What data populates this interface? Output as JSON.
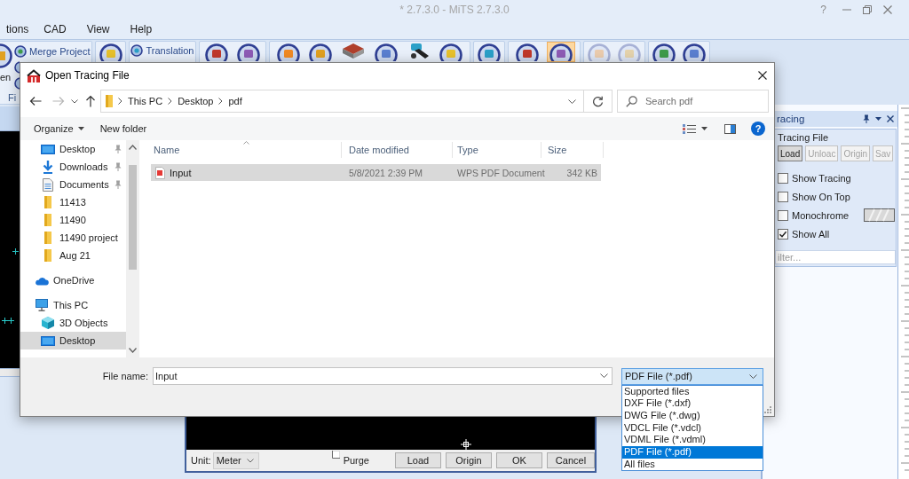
{
  "app": {
    "title": "* 2.7.3.0 - MiTS 2.7.3.0",
    "help": "?"
  },
  "menu": [
    {
      "label": "tions"
    },
    {
      "label": "CAD"
    },
    {
      "label": "View"
    },
    {
      "label": "Help"
    }
  ],
  "ribbon": {
    "groups": [
      {
        "label": "Fi",
        "items": [
          {
            "kind": "large",
            "label": "en",
            "active": false,
            "disabled": false
          },
          {
            "kind": "small",
            "label": "Merge Project",
            "active": false,
            "disabled": false
          },
          {
            "kind": "small",
            "active": false,
            "disabled": false
          },
          {
            "kind": "small",
            "active": false,
            "disabled": false
          }
        ]
      },
      {
        "items": [
          {
            "kind": "round",
            "active": false,
            "disabled": false
          }
        ]
      },
      {
        "items": [
          {
            "kind": "small",
            "label": "Translation",
            "active": false,
            "disabled": false
          }
        ]
      },
      {
        "items": [
          {
            "kind": "round",
            "active": false,
            "disabled": false
          },
          {
            "kind": "round",
            "active": false,
            "disabled": false
          }
        ]
      },
      {
        "items": [
          {
            "kind": "round",
            "active": false,
            "disabled": false
          },
          {
            "kind": "round",
            "active": false,
            "disabled": false
          },
          {
            "kind": "slab",
            "active": false,
            "disabled": false
          },
          {
            "kind": "round",
            "active": false,
            "disabled": false
          },
          {
            "kind": "machine",
            "active": false,
            "disabled": false
          },
          {
            "kind": "round",
            "active": false,
            "disabled": false
          }
        ]
      },
      {
        "items": [
          {
            "kind": "round",
            "active": false,
            "disabled": false
          }
        ]
      },
      {
        "items": [
          {
            "kind": "round",
            "active": false,
            "disabled": false
          },
          {
            "kind": "round",
            "active": true,
            "disabled": false
          }
        ]
      },
      {
        "items": [
          {
            "kind": "round",
            "active": false,
            "disabled": true
          },
          {
            "kind": "round",
            "active": false,
            "disabled": true
          }
        ]
      },
      {
        "items": [
          {
            "kind": "round",
            "active": false,
            "disabled": false
          },
          {
            "kind": "round",
            "active": false,
            "disabled": false
          }
        ]
      }
    ]
  },
  "dialog": {
    "title": "Open Tracing File",
    "address": {
      "crumbs": [
        "This PC",
        "Desktop",
        "pdf"
      ]
    },
    "search": {
      "placeholder": "Search pdf"
    },
    "toolbar": {
      "organize": "Organize",
      "new_folder": "New folder",
      "help": "?"
    },
    "nav": {
      "quick_access": [
        {
          "label": "Desktop",
          "kind": "desktop",
          "pinned": true,
          "selected": false
        },
        {
          "label": "Downloads",
          "kind": "downloads",
          "pinned": true,
          "selected": false
        },
        {
          "label": "Documents",
          "kind": "documents",
          "pinned": true,
          "selected": false
        },
        {
          "label": "11413",
          "kind": "folder",
          "pinned": false,
          "selected": false
        },
        {
          "label": "11490",
          "kind": "folder",
          "pinned": false,
          "selected": false
        },
        {
          "label": "11490 project",
          "kind": "folder",
          "pinned": false,
          "selected": false
        },
        {
          "label": "Aug 21",
          "kind": "folder",
          "pinned": false,
          "selected": false
        }
      ],
      "items": [
        {
          "label": "OneDrive",
          "kind": "cloud",
          "selected": false
        },
        {
          "label": "This PC",
          "kind": "pc",
          "selected": false,
          "children": [
            {
              "label": "3D Objects",
              "kind": "cube",
              "selected": false
            },
            {
              "label": "Desktop",
              "kind": "desktop",
              "selected": true
            }
          ]
        }
      ]
    },
    "columns": [
      {
        "label": "Name",
        "sorted": true
      },
      {
        "label": "Date modified",
        "sorted": false
      },
      {
        "label": "Type",
        "sorted": false
      },
      {
        "label": "Size",
        "sorted": false
      }
    ],
    "files": [
      {
        "name": "Input",
        "date": "5/8/2021 2:39 PM",
        "type": "WPS PDF Document",
        "size": "342 KB",
        "selected": true
      }
    ],
    "file_name": {
      "label": "File name:",
      "value": "Input"
    },
    "file_type": {
      "value": "PDF File (*.pdf)",
      "expanded": true,
      "options": [
        {
          "label": "Supported files",
          "selected": false
        },
        {
          "label": "DXF File (*.dxf)",
          "selected": false
        },
        {
          "label": "DWG File (*.dwg)",
          "selected": false
        },
        {
          "label": "VDCL File (*.vdcl)",
          "selected": false
        },
        {
          "label": "VDML File (*.vdml)",
          "selected": false
        },
        {
          "label": "PDF File (*.pdf)",
          "selected": true
        },
        {
          "label": "All files",
          "selected": false
        }
      ]
    }
  },
  "tracing_panel": {
    "title": "racing",
    "group_label": "Tracing File",
    "buttons": [
      {
        "label": "Load",
        "disabled": false
      },
      {
        "label": "Unloac",
        "disabled": true
      },
      {
        "label": "Origin",
        "disabled": true
      },
      {
        "label": "Sav",
        "disabled": true
      }
    ],
    "options": [
      {
        "label": "Show Tracing",
        "kind": "check",
        "checked": false
      },
      {
        "label": "Show On Top",
        "kind": "check",
        "checked": false
      },
      {
        "label": "Monochrome",
        "kind": "check-swatch",
        "checked": false
      },
      {
        "label": "Show All",
        "kind": "check",
        "checked": true
      }
    ],
    "filter": {
      "placeholder": "ilter..."
    }
  },
  "preview": {
    "unit_label": "Unit:",
    "unit": "Meter",
    "purge": {
      "label": "Purge",
      "checked": false
    },
    "buttons": [
      {
        "label": "Load"
      },
      {
        "label": "Origin"
      },
      {
        "label": "OK"
      },
      {
        "label": "Cancel"
      }
    ]
  }
}
